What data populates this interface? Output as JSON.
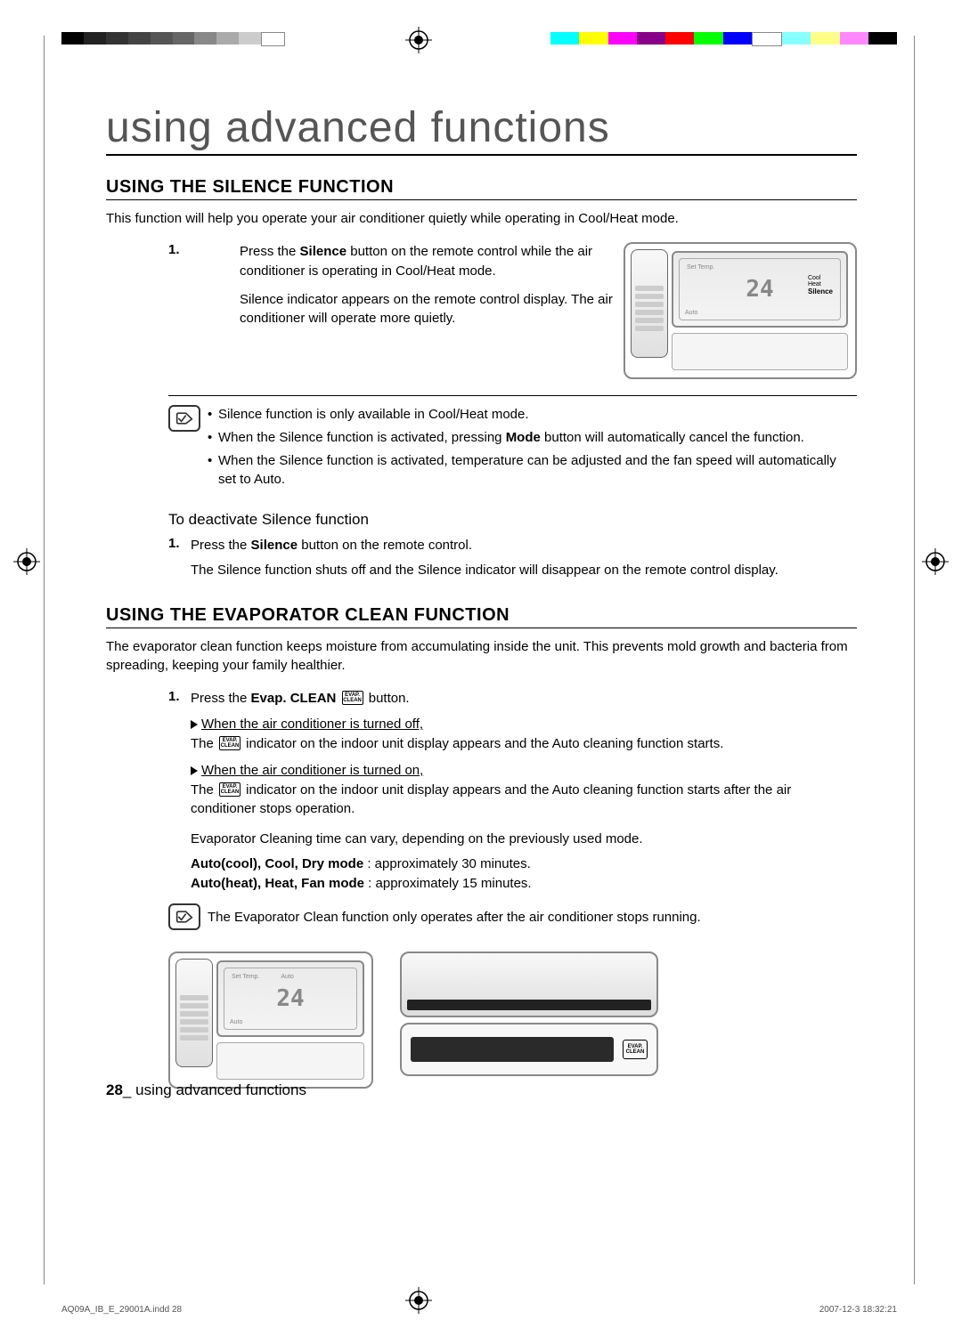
{
  "chapter": "using advanced functions",
  "section1": {
    "title": "USING THE SILENCE FUNCTION",
    "intro": "This function will help you operate your air conditioner quietly while operating in Cool/Heat mode.",
    "step1_num": "1.",
    "step1_a": "Press the ",
    "step1_b": "Silence",
    "step1_c": " button on the remote control while the air conditioner is operating in Cool/Heat mode.",
    "step1_d": "Silence indicator appears on the remote control display. The air conditioner will operate more quietly.",
    "note1": "Silence function is only available in Cool/Heat mode.",
    "note2a": "When the Silence function is activated, pressing ",
    "note2b": "Mode",
    "note2c": " button will automatically cancel the function.",
    "note3": "When the Silence function is activated, temperature can be adjusted and the fan speed will automatically set to Auto.",
    "deact_head": "To deactivate Silence function",
    "deact1_num": "1.",
    "deact1_a": "Press the ",
    "deact1_b": "Silence",
    "deact1_c": " button on the remote control.",
    "deact1_para": "The Silence function shuts off and the Silence indicator will disappear on the remote control display."
  },
  "section2": {
    "title": "USING THE EVAPORATOR CLEAN FUNCTION",
    "intro": "The evaporator clean function keeps moisture from accumulating inside the unit. This prevents mold growth and bacteria from spreading, keeping your family healthier.",
    "step1_num": "1.",
    "step1_a": "Press the ",
    "step1_b": "Evap. CLEAN",
    "step1_c": " button.",
    "case_off": "When the air conditioner is turned off,",
    "case_off_body_a": "The ",
    "case_off_body_b": " indicator on the indoor unit display appears and the Auto cleaning function starts.",
    "case_on": "When the air conditioner is turned on,",
    "case_on_body_a": "The ",
    "case_on_body_b": " indicator on the indoor unit display appears and the Auto cleaning function starts after the air conditioner stops operation.",
    "time_note": "Evaporator Cleaning time can vary, depending on the previously used mode.",
    "mode1_a": "Auto(cool), Cool, Dry mode",
    "mode1_b": " : approximately 30 minutes.",
    "mode2_a": "Auto(heat), Heat, Fan mode",
    "mode2_b": " : approximately 15 minutes.",
    "final_note": "The Evaporator Clean function only operates after the air conditioner stops running."
  },
  "fig_labels": {
    "set_temp": "Set Temp.",
    "cool": "Cool",
    "heat": "Heat",
    "silence": "Silence",
    "auto": "Auto",
    "temp": "24",
    "evap": "EVAP.\nCLEAN"
  },
  "footer": {
    "page": "28",
    "sep": "_",
    "text": " using advanced functions"
  },
  "print": {
    "left": "AQ09A_IB_E_29001A.indd   28",
    "right": "2007-12-3   18:32:21"
  }
}
